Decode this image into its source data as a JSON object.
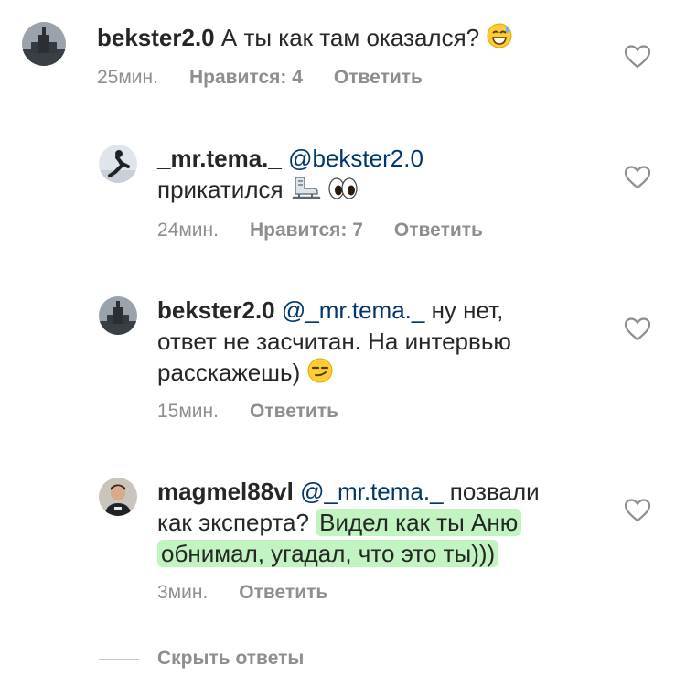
{
  "comments": [
    {
      "username": "bekster2.0",
      "mention": "",
      "text": "А ты как там оказался?",
      "emoji": "grin-sweat",
      "time": "25мин.",
      "likes": "Нравится: 4",
      "reply": "Ответить"
    },
    {
      "username": "_mr.tema._",
      "mention": "@bekster2.0",
      "text": "прикатился",
      "emoji": "skate-eyes",
      "time": "24мин.",
      "likes": "Нравится: 7",
      "reply": "Ответить"
    },
    {
      "username": "bekster2.0",
      "mention": "@_mr.tema._",
      "text_1": "ну нет,",
      "text_2": "ответ не засчитан. На интервью",
      "text_3": "расскажешь)",
      "emoji": "smirk",
      "time": "15мин.",
      "reply": "Ответить"
    },
    {
      "username": "magmel88vl",
      "mention": "@_mr.tema._",
      "text_1": "позвали",
      "text_2": "как эксперта?",
      "highlight_1": "Видел как ты Аню",
      "highlight_2": "обнимал, угадал, что это ты)))",
      "time": "3мин.",
      "reply": "Ответить"
    }
  ],
  "hide_replies": "Скрыть ответы",
  "colors": {
    "text": "#262626",
    "meta": "#8e8e8e",
    "mention": "#00376b",
    "highlight": "#8ee68e"
  }
}
